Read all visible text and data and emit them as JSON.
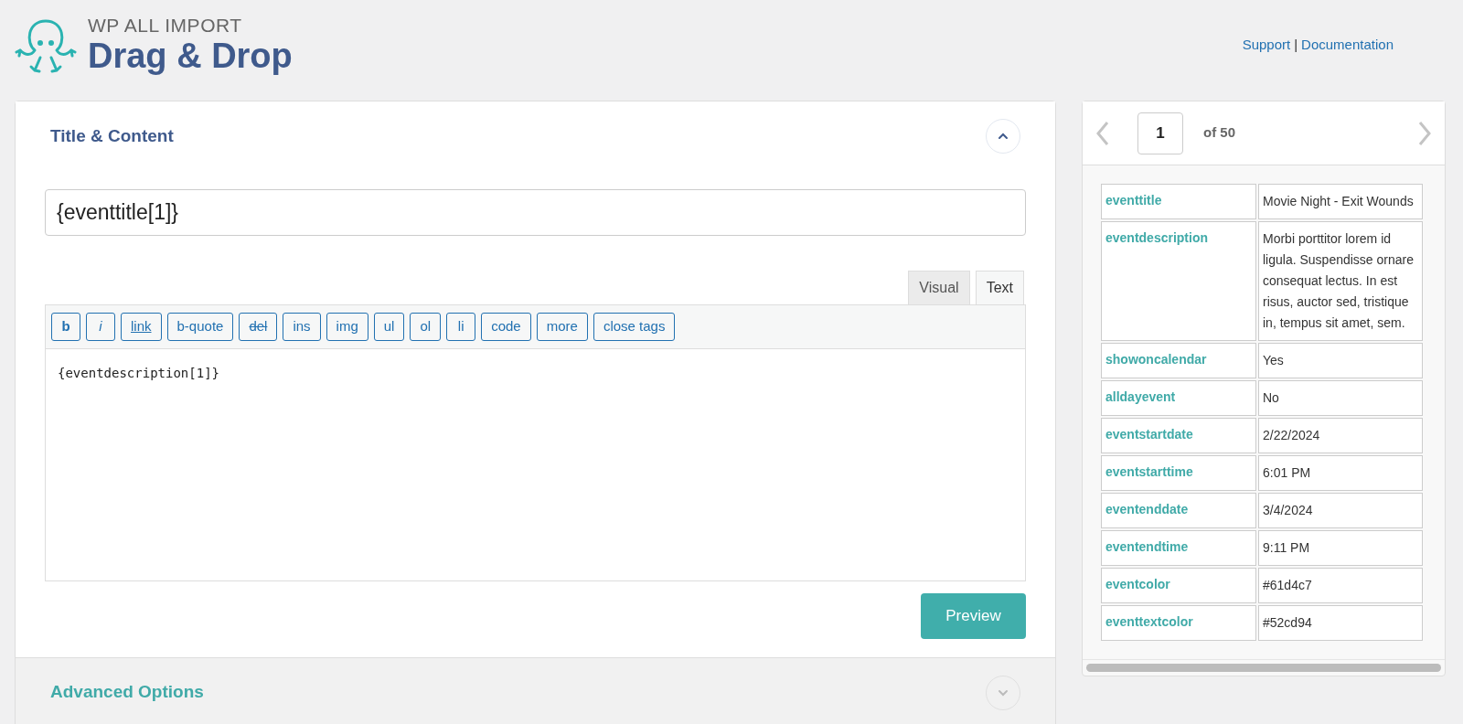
{
  "header": {
    "brand_top": "WP ALL IMPORT",
    "brand_main": "Drag & Drop",
    "links": [
      "Support",
      "Documentation"
    ],
    "separator": "|"
  },
  "sections": [
    {
      "title": "Title & Content",
      "expanded": true
    },
    {
      "title": "Advanced Options",
      "expanded": false
    }
  ],
  "title_field": {
    "value": "{eventtitle[1]}"
  },
  "editor_tabs": [
    {
      "label": "Visual",
      "selected": false
    },
    {
      "label": "Text",
      "selected": true
    }
  ],
  "toolbar": [
    {
      "label": "b",
      "kind": "bold"
    },
    {
      "label": "i",
      "kind": "italic"
    },
    {
      "label": "link",
      "kind": "underline"
    },
    {
      "label": "b-quote",
      "kind": "plain"
    },
    {
      "label": "del",
      "kind": "strike"
    },
    {
      "label": "ins",
      "kind": "plain"
    },
    {
      "label": "img",
      "kind": "plain"
    },
    {
      "label": "ul",
      "kind": "plain"
    },
    {
      "label": "ol",
      "kind": "plain"
    },
    {
      "label": "li",
      "kind": "plain"
    },
    {
      "label": "code",
      "kind": "plain"
    },
    {
      "label": "more",
      "kind": "plain"
    },
    {
      "label": "close tags",
      "kind": "plain"
    }
  ],
  "editor_content": "{eventdescription[1]}",
  "preview_button": "Preview",
  "pager": {
    "value": "1",
    "of": "of 50"
  },
  "record": [
    {
      "field": "eventtitle",
      "value": "Movie Night - Exit Wounds"
    },
    {
      "field": "eventdescription",
      "value": "Morbi porttitor lorem id ligula. Suspendisse ornare consequat lectus. In est risus, auctor sed, tristique in, tempus sit amet, sem."
    },
    {
      "field": "showoncalendar",
      "value": "Yes"
    },
    {
      "field": "alldayevent",
      "value": "No"
    },
    {
      "field": "eventstartdate",
      "value": "2/22/2024"
    },
    {
      "field": "eventstarttime",
      "value": "6:01 PM"
    },
    {
      "field": "eventenddate",
      "value": "3/4/2024"
    },
    {
      "field": "eventendtime",
      "value": "9:11 PM"
    },
    {
      "field": "eventcolor",
      "value": "#61d4c7"
    },
    {
      "field": "eventtextcolor",
      "value": "#52cd94"
    }
  ]
}
